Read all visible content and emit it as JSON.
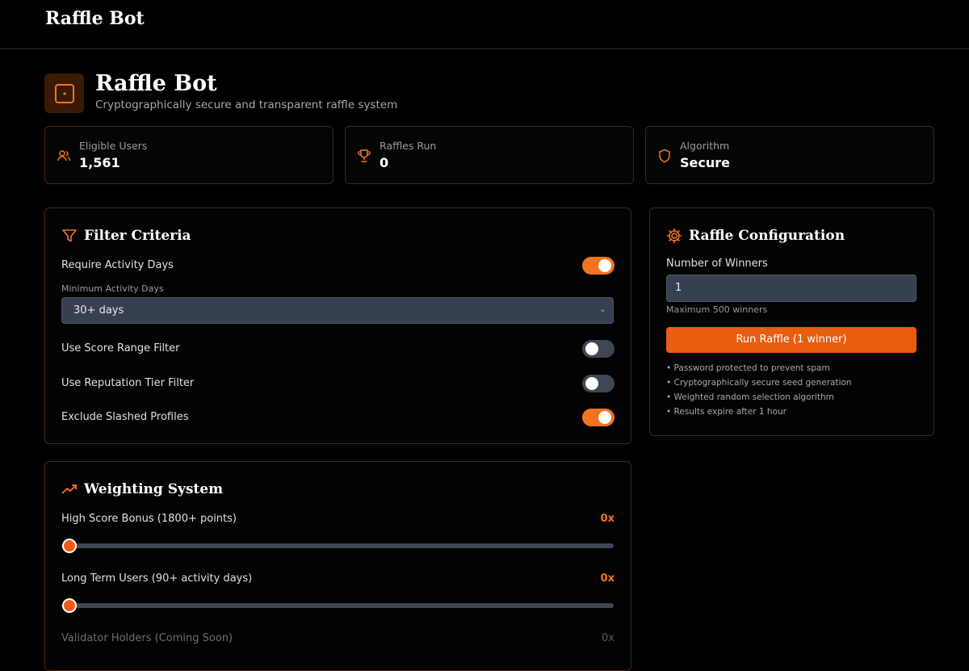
{
  "header": {
    "brand": "Raffle Bot"
  },
  "hero": {
    "title": "Raffle Bot",
    "subtitle": "Cryptographically secure and transparent raffle system"
  },
  "stats": [
    {
      "label": "Eligible Users",
      "value": "1,561",
      "icon": "users-icon"
    },
    {
      "label": "Raffles Run",
      "value": "0",
      "icon": "trophy-icon"
    },
    {
      "label": "Algorithm",
      "value": "Secure",
      "icon": "shield-icon"
    }
  ],
  "filter": {
    "title": "Filter Criteria",
    "require_activity_label": "Require Activity Days",
    "require_activity_on": true,
    "min_activity_label": "Minimum Activity Days",
    "min_activity_value": "30+ days",
    "score_range_label": "Use Score Range Filter",
    "score_range_on": false,
    "reputation_label": "Use Reputation Tier Filter",
    "reputation_on": false,
    "exclude_slashed_label": "Exclude Slashed Profiles",
    "exclude_slashed_on": true
  },
  "weighting": {
    "title": "Weighting System",
    "items": [
      {
        "label": "High Score Bonus (1800+ points)",
        "value": "0x",
        "level": 0
      },
      {
        "label": "Long Term Users (90+ activity days)",
        "value": "0x",
        "level": 0
      },
      {
        "label": "Validator Holders (Coming Soon)",
        "value": "0x",
        "level": 0
      }
    ]
  },
  "config": {
    "title": "Raffle Configuration",
    "winners_label": "Number of Winners",
    "winners_value": "1",
    "winners_hint": "Maximum 500 winners",
    "run_label": "Run Raffle (1 winner)",
    "notes": [
      "• Password protected to prevent spam",
      "• Cryptographically secure seed generation",
      "• Weighted random selection algorithm",
      "• Results expire after 1 hour"
    ]
  },
  "colors": {
    "accent": "#f47321",
    "background": "#000000",
    "border": "#4a2410"
  }
}
